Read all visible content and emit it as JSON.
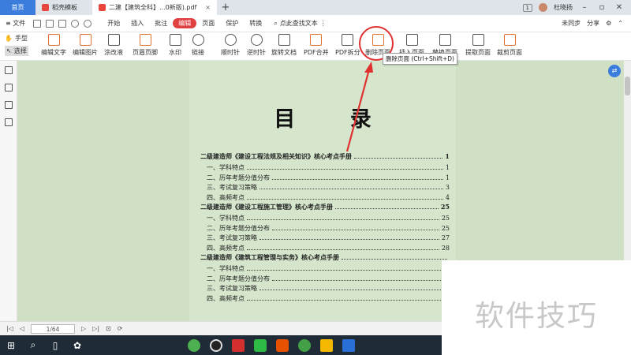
{
  "tabs": {
    "home": "首页",
    "doc": "稻壳模板",
    "pdf": "二建【建筑全科】...0新版).pdf",
    "close": "×",
    "add": "+"
  },
  "titlebar": {
    "count": "1",
    "user": "杜晓扬"
  },
  "menu": {
    "file": "≡ 文件",
    "items": [
      "开始",
      "插入",
      "批注",
      "编辑",
      "页面",
      "保护",
      "转换"
    ],
    "active_index": 3,
    "search": "点此查找文本",
    "sync": "未同步",
    "share": "分享"
  },
  "toolbar": {
    "hand": "手型",
    "select": "选择",
    "tools": [
      "编辑文字",
      "编辑图片",
      "涂改液",
      "页眉页脚",
      "水印",
      "链接",
      "顺时针",
      "逆时针",
      "旋转文档",
      "PDF合并",
      "PDF拆分",
      "删除页面",
      "插入页面",
      "替换页面",
      "提取页面",
      "裁剪页面"
    ],
    "tooltip": "删除页面 (Ctrl+Shift+D)"
  },
  "document": {
    "title": "目 录",
    "toc": [
      {
        "level": 1,
        "text": "二级建造师《建设工程法规及相关知识》核心考点手册",
        "page": "1"
      },
      {
        "level": 2,
        "text": "一、学科特点",
        "page": "1"
      },
      {
        "level": 2,
        "text": "二、历年考题分值分布",
        "page": "1"
      },
      {
        "level": 2,
        "text": "三、考试复习策略",
        "page": "3"
      },
      {
        "level": 2,
        "text": "四、高频考点",
        "page": "4"
      },
      {
        "level": 1,
        "text": "二级建造师《建设工程施工管理》核心考点手册",
        "page": "25"
      },
      {
        "level": 2,
        "text": "一、学科特点",
        "page": "25"
      },
      {
        "level": 2,
        "text": "二、历年考题分值分布",
        "page": "25"
      },
      {
        "level": 2,
        "text": "三、考试复习策略",
        "page": "27"
      },
      {
        "level": 2,
        "text": "四、高频考点",
        "page": "28"
      },
      {
        "level": 1,
        "text": "二级建造师《建筑工程管理与实务》核心考点手册",
        "page": ""
      },
      {
        "level": 2,
        "text": "一、学科特点",
        "page": ""
      },
      {
        "level": 2,
        "text": "二、历年考题分值分布",
        "page": ""
      },
      {
        "level": 2,
        "text": "三、考试复习策略",
        "page": ""
      },
      {
        "level": 2,
        "text": "四、高频考点",
        "page": ""
      }
    ]
  },
  "status": {
    "page": "1/64"
  },
  "watermark": "软件技巧",
  "colors": {
    "accent": "#3b7ddd",
    "highlight": "#e03030",
    "page_bg": "#d5e6cc"
  }
}
